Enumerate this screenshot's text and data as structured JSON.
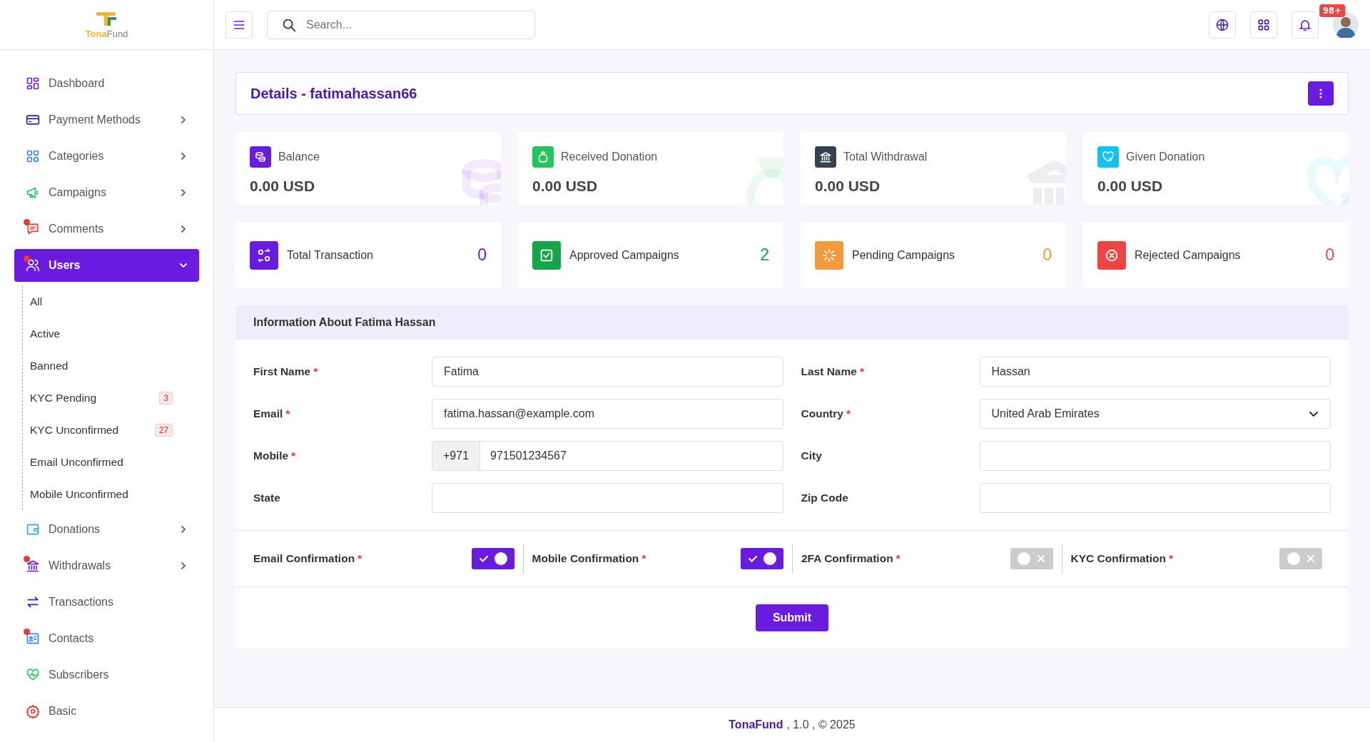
{
  "logo": {
    "first": "Tona",
    "second": "Fund"
  },
  "search": {
    "placeholder": "Search..."
  },
  "notifications": {
    "badge": "98+"
  },
  "sidebar": {
    "items": [
      {
        "label": "Dashboard",
        "expandable": false,
        "selected": false,
        "notify": false
      },
      {
        "label": "Payment Methods",
        "expandable": true,
        "expanded": false,
        "selected": false,
        "notify": false
      },
      {
        "label": "Categories",
        "expandable": true,
        "expanded": false,
        "selected": false,
        "notify": false
      },
      {
        "label": "Campaigns",
        "expandable": true,
        "expanded": false,
        "selected": false,
        "notify": false
      },
      {
        "label": "Comments",
        "expandable": true,
        "expanded": false,
        "selected": false,
        "notify": true
      },
      {
        "label": "Users",
        "expandable": true,
        "expanded": true,
        "selected": true,
        "notify": true,
        "children": [
          {
            "label": "All"
          },
          {
            "label": "Active"
          },
          {
            "label": "Banned"
          },
          {
            "label": "KYC Pending",
            "badge": "3"
          },
          {
            "label": "KYC Unconfirmed",
            "badge": "27"
          },
          {
            "label": "Email Unconfirmed"
          },
          {
            "label": "Mobile Unconfirmed"
          }
        ]
      },
      {
        "label": "Donations",
        "expandable": true,
        "expanded": false,
        "selected": false,
        "notify": false
      },
      {
        "label": "Withdrawals",
        "expandable": true,
        "expanded": false,
        "selected": false,
        "notify": true
      },
      {
        "label": "Transactions",
        "expandable": false,
        "selected": false,
        "notify": false
      },
      {
        "label": "Contacts",
        "expandable": false,
        "selected": false,
        "notify": true
      },
      {
        "label": "Subscribers",
        "expandable": false,
        "selected": false,
        "notify": false
      },
      {
        "label": "Basic",
        "expandable": false,
        "selected": false,
        "notify": false
      }
    ]
  },
  "page_header": {
    "title": "Details - fatimahassan66"
  },
  "balance_cards": [
    {
      "label": "Balance",
      "value": "0.00 USD",
      "color": "#6a1be0"
    },
    {
      "label": "Received Donation",
      "value": "0.00 USD",
      "color": "#22c55e"
    },
    {
      "label": "Total Withdrawal",
      "value": "0.00 USD",
      "color": "#374151"
    },
    {
      "label": "Given Donation",
      "value": "0.00 USD",
      "color": "#0ec3f0"
    }
  ],
  "count_cards": [
    {
      "label": "Total Transaction",
      "value": "0",
      "color": "#6a1be0"
    },
    {
      "label": "Approved Campaigns",
      "value": "2",
      "color": "#16a34a"
    },
    {
      "label": "Pending Campaigns",
      "value": "0",
      "color": "#f59a3c"
    },
    {
      "label": "Rejected Campaigns",
      "value": "0",
      "color": "#ef4444"
    }
  ],
  "info_panel": {
    "title": "Information About Fatima Hassan",
    "fields": [
      {
        "label": "First Name",
        "required": true,
        "kind": "text",
        "value": "Fatima"
      },
      {
        "label": "Last Name",
        "required": true,
        "kind": "text",
        "value": "Hassan"
      },
      {
        "label": "Email",
        "required": true,
        "kind": "text",
        "value": "fatima.hassan@example.com"
      },
      {
        "label": "Country",
        "required": true,
        "kind": "select",
        "value": "United Arab Emirates"
      },
      {
        "label": "Mobile",
        "required": true,
        "kind": "phone",
        "prefix": "+971",
        "value": "971501234567"
      },
      {
        "label": "City",
        "required": false,
        "kind": "text"
      },
      {
        "label": "State",
        "required": false,
        "kind": "text"
      },
      {
        "label": "Zip Code",
        "required": false,
        "kind": "text"
      }
    ],
    "toggles": [
      {
        "label": "Email Confirmation",
        "required": true,
        "on": true
      },
      {
        "label": "Mobile Confirmation",
        "required": true,
        "on": true
      },
      {
        "label": "2FA Confirmation",
        "required": true,
        "on": false
      },
      {
        "label": "KYC Confirmation",
        "required": true,
        "on": false
      }
    ],
    "submit": "Submit"
  },
  "required_mark": "*",
  "footer": {
    "brand": "TonaFund",
    "text": ", 1.0 , © 2025"
  }
}
